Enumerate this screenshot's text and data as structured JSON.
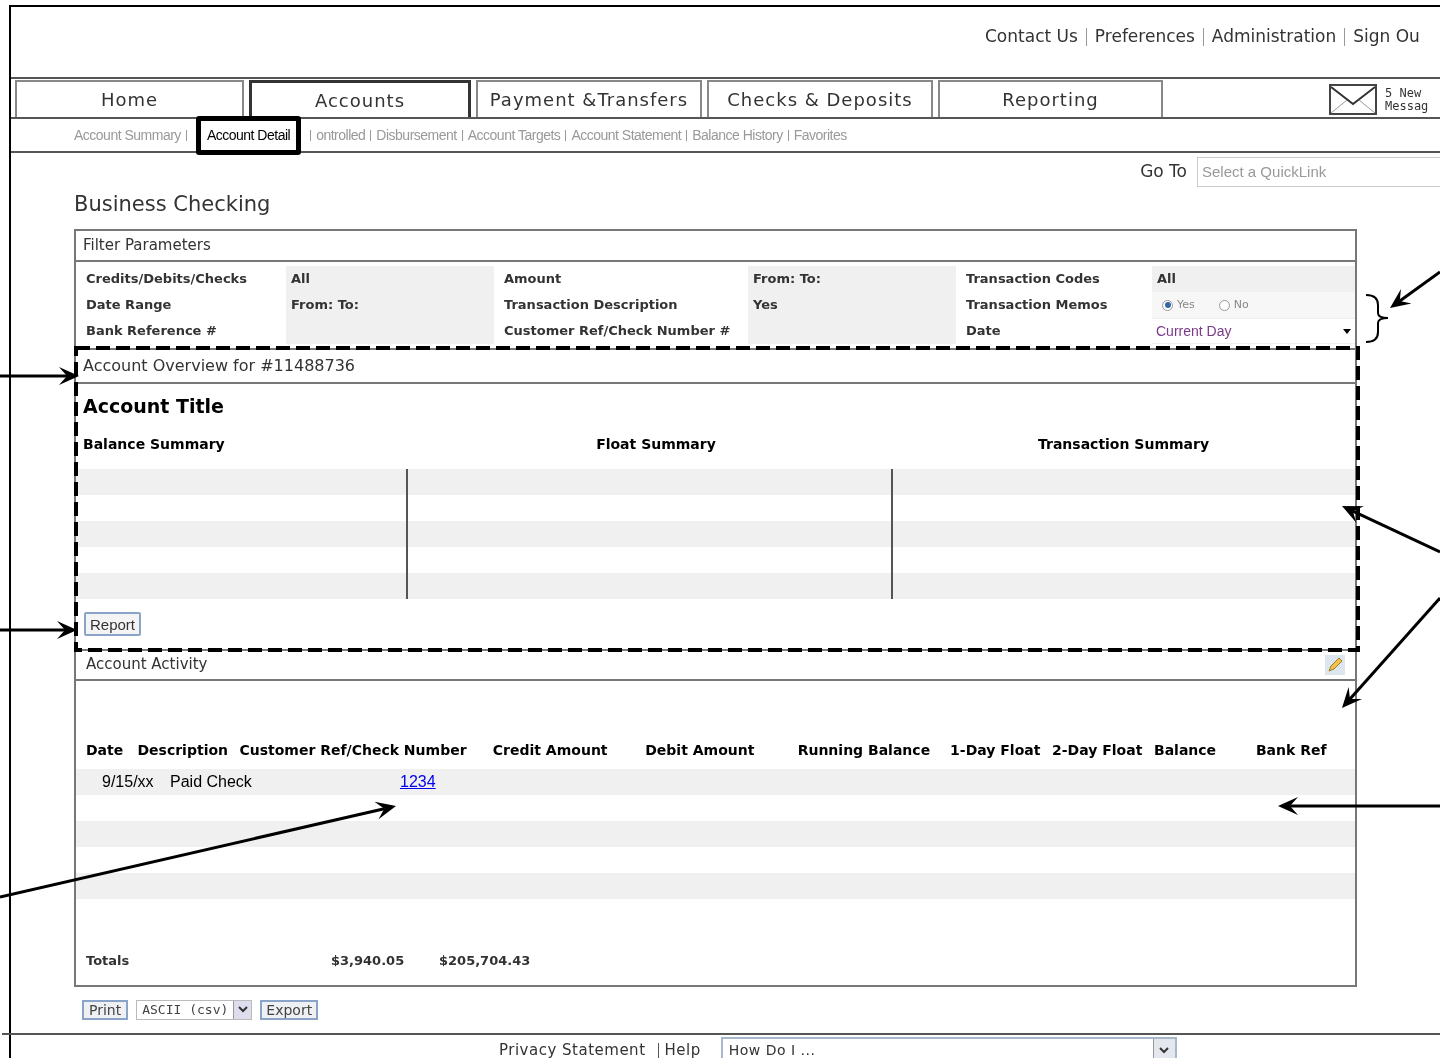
{
  "top_links": [
    "Contact Us",
    "Preferences",
    "Administration",
    "Sign Ou"
  ],
  "tabs": [
    {
      "label": "Home",
      "selected": false
    },
    {
      "label": "Accounts",
      "selected": true
    },
    {
      "label": "Payment &Transfers",
      "selected": false
    },
    {
      "label": "Checks & Deposits",
      "selected": false
    },
    {
      "label": "Reporting",
      "selected": false
    }
  ],
  "messages": {
    "line_1": "5 New",
    "line_2": "Messag"
  },
  "subnav": [
    {
      "label": "Account Summary",
      "selected": false
    },
    {
      "label": "Account Detail",
      "selected": true
    },
    {
      "label": "ontrolled",
      "selected": false
    },
    {
      "label": "Disbursement",
      "selected": false
    },
    {
      "label": "Account Targets",
      "selected": false
    },
    {
      "label": "Account Statement",
      "selected": false
    },
    {
      "label": "Balance History",
      "selected": false
    },
    {
      "label": "Favorites",
      "selected": false
    }
  ],
  "goto": {
    "label": "Go To",
    "placeholder": "Select a QuickLink"
  },
  "page_title": "Business Checking",
  "filter": {
    "title": "Filter Parameters",
    "rows": [
      [
        {
          "kind": "label",
          "text": "Credits/Debits/Checks"
        },
        {
          "kind": "value",
          "text": "All"
        },
        {
          "kind": "label",
          "text": "Amount"
        },
        {
          "kind": "value",
          "text": "From: To:"
        },
        {
          "kind": "label",
          "text": "Transaction Codes"
        },
        {
          "kind": "value",
          "text": "All"
        }
      ],
      [
        {
          "kind": "label",
          "text": "Date Range"
        },
        {
          "kind": "value",
          "text": "From:  To:"
        },
        {
          "kind": "label",
          "text": "Transaction Description"
        },
        {
          "kind": "value",
          "text": "Yes"
        },
        {
          "kind": "label",
          "text": "Transaction Memos"
        },
        {
          "kind": "radios",
          "options": [
            {
              "label": "Yes",
              "selected": true
            },
            {
              "label": "No",
              "selected": false
            }
          ]
        }
      ],
      [
        {
          "kind": "label",
          "text": "Bank Reference #"
        },
        {
          "kind": "value",
          "text": ""
        },
        {
          "kind": "label",
          "text": "Customer Ref/Check Number #"
        },
        {
          "kind": "value",
          "text": ""
        },
        {
          "kind": "label",
          "text": "Date"
        },
        {
          "kind": "select",
          "text": "Current Day"
        }
      ]
    ]
  },
  "overview": {
    "title": "Account Overview for #11488736",
    "account_title": "Account Title",
    "summaries": [
      "Balance Summary",
      "Float Summary",
      "Transaction Summary"
    ],
    "report_button": "Report"
  },
  "activity": {
    "title": "Account Activity",
    "columns": [
      "Date",
      "Description",
      "Customer Ref/Check Number",
      "Credit Amount",
      "Debit Amount",
      "Running Balance",
      "1-Day Float",
      "2-Day Float",
      "Balance",
      "Bank Ref"
    ],
    "rows": [
      {
        "date": "9/15/xx",
        "description": "Paid Check",
        "check_number": "1234"
      }
    ],
    "totals": {
      "label": "Totals",
      "credit": "$3,940.05",
      "debit": "$205,704.43"
    }
  },
  "export": {
    "print": "Print",
    "format": "ASCII (csv)",
    "export": "Export"
  },
  "footer": {
    "links": [
      "Privacy Statement",
      "Help"
    ],
    "howdoi": "How Do I ..."
  }
}
